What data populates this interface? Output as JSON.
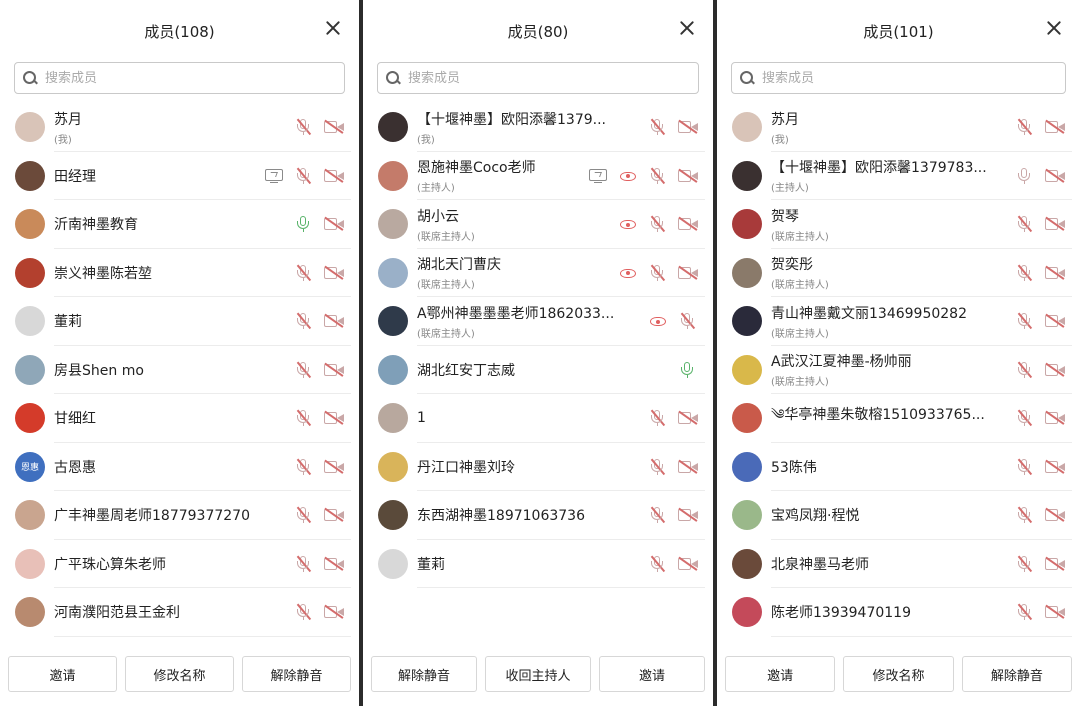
{
  "panels": [
    {
      "title": "成员(108)",
      "search_placeholder": "搜索成员",
      "members": [
        {
          "name": "苏月",
          "role": "(我)",
          "avatar_color": "#d9c4b8",
          "share": false,
          "eye": false,
          "mic": "muted",
          "cam": true
        },
        {
          "name": "田经理",
          "role": "",
          "avatar_color": "#6b4a3a",
          "share": true,
          "eye": false,
          "mic": "muted",
          "cam": true
        },
        {
          "name": "沂南神墨教育",
          "role": "",
          "avatar_color": "#c98a5a",
          "share": false,
          "eye": false,
          "mic": "on",
          "cam": true
        },
        {
          "name": "崇义神墨陈若堃",
          "role": "",
          "avatar_color": "#b3402e",
          "share": false,
          "eye": false,
          "mic": "muted",
          "cam": true
        },
        {
          "name": "董莉",
          "role": "",
          "avatar_color": "#d8d8d8",
          "share": false,
          "eye": false,
          "mic": "muted",
          "cam": true
        },
        {
          "name": "房县Shen mo",
          "role": "",
          "avatar_color": "#8fa7b8",
          "share": false,
          "eye": false,
          "mic": "muted",
          "cam": true
        },
        {
          "name": "甘细红",
          "role": "",
          "avatar_color": "#d43b2a",
          "share": false,
          "eye": false,
          "mic": "muted",
          "cam": true
        },
        {
          "name": "古恩惠",
          "role": "",
          "avatar_color": "#3f6fbf",
          "avatar_text": "恩惠",
          "share": false,
          "eye": false,
          "mic": "muted",
          "cam": true
        },
        {
          "name": "广丰神墨周老师18779377270",
          "role": "",
          "avatar_color": "#c9a58f",
          "share": false,
          "eye": false,
          "mic": "muted",
          "cam": true
        },
        {
          "name": "广平珠心算朱老师",
          "role": "",
          "avatar_color": "#e8c0b8",
          "share": false,
          "eye": false,
          "mic": "muted",
          "cam": true
        },
        {
          "name": "河南濮阳范县王金利",
          "role": "",
          "avatar_color": "#b88a6f",
          "share": false,
          "eye": false,
          "mic": "muted",
          "cam": true
        }
      ],
      "buttons": [
        "邀请",
        "修改名称",
        "解除静音"
      ]
    },
    {
      "title": "成员(80)",
      "search_placeholder": "搜索成员",
      "members": [
        {
          "name": "【十堰神墨】欧阳添馨1379...",
          "role": "(我)",
          "avatar_color": "#3a3030",
          "share": false,
          "eye": false,
          "mic": "muted",
          "cam": true
        },
        {
          "name": "恩施神墨Coco老师",
          "role": "(主持人)",
          "avatar_color": "#c47b6a",
          "share": true,
          "eye": true,
          "mic": "muted",
          "cam": true
        },
        {
          "name": "胡小云",
          "role": "(联席主持人)",
          "avatar_color": "#b9a9a0",
          "share": false,
          "eye": true,
          "mic": "muted",
          "cam": true
        },
        {
          "name": "湖北天门曹庆",
          "role": "(联席主持人)",
          "avatar_color": "#9ab0c8",
          "share": false,
          "eye": true,
          "mic": "muted",
          "cam": true
        },
        {
          "name": "A鄂州神墨墨墨老师1862033...",
          "role": "(联席主持人)",
          "avatar_color": "#2f3a4a",
          "share": false,
          "eye": true,
          "mic": "muted",
          "cam": false
        },
        {
          "name": "湖北红安丁志威",
          "role": "",
          "avatar_color": "#7f9fb8",
          "share": false,
          "eye": false,
          "mic": "on",
          "cam": false
        },
        {
          "name": "1",
          "role": "",
          "avatar_color": "#b8a89e",
          "share": false,
          "eye": false,
          "mic": "muted",
          "cam": true
        },
        {
          "name": "丹江口神墨刘玲",
          "role": "",
          "avatar_color": "#d9b45a",
          "share": false,
          "eye": false,
          "mic": "muted",
          "cam": true
        },
        {
          "name": "东西湖神墨18971063736",
          "role": "",
          "avatar_color": "#5a4a3a",
          "share": false,
          "eye": false,
          "mic": "muted",
          "cam": true
        },
        {
          "name": "董莉",
          "role": "",
          "avatar_color": "#d8d8d8",
          "share": false,
          "eye": false,
          "mic": "muted",
          "cam": true
        }
      ],
      "buttons": [
        "解除静音",
        "收回主持人",
        "邀请"
      ]
    },
    {
      "title": "成员(101)",
      "search_placeholder": "搜索成员",
      "members": [
        {
          "name": "苏月",
          "role": "(我)",
          "avatar_color": "#d9c4b8",
          "share": false,
          "eye": false,
          "mic": "muted",
          "cam": true
        },
        {
          "name": "【十堰神墨】欧阳添馨1379783...",
          "role": "(主持人)",
          "avatar_color": "#3a3030",
          "share": false,
          "eye": false,
          "mic": "plain",
          "cam": true
        },
        {
          "name": "贺琴",
          "role": "(联席主持人)",
          "avatar_color": "#a83a3a",
          "share": false,
          "eye": false,
          "mic": "muted",
          "cam": true
        },
        {
          "name": "贺奕彤",
          "role": "(联席主持人)",
          "avatar_color": "#8a7a6a",
          "share": false,
          "eye": false,
          "mic": "muted",
          "cam": true
        },
        {
          "name": "青山神墨戴文丽13469950282",
          "role": "(联席主持人)",
          "avatar_color": "#2a2a3a",
          "share": false,
          "eye": false,
          "mic": "muted",
          "cam": true
        },
        {
          "name": "A武汉江夏神墨-杨帅丽",
          "role": "(联席主持人)",
          "avatar_color": "#d9b84a",
          "share": false,
          "eye": false,
          "mic": "muted",
          "cam": true
        },
        {
          "name": "༄华亭神墨朱敬榕1510933765...",
          "role": "",
          "avatar_color": "#c95a4a",
          "share": false,
          "eye": false,
          "mic": "muted",
          "cam": true
        },
        {
          "name": "53陈伟",
          "role": "",
          "avatar_color": "#4a6ab8",
          "share": false,
          "eye": false,
          "mic": "muted",
          "cam": true
        },
        {
          "name": "宝鸡凤翔·程悦",
          "role": "",
          "avatar_color": "#9ab88a",
          "share": false,
          "eye": false,
          "mic": "muted",
          "cam": true
        },
        {
          "name": "北泉神墨马老师",
          "role": "",
          "avatar_color": "#6a4a3a",
          "share": false,
          "eye": false,
          "mic": "muted",
          "cam": true
        },
        {
          "name": "陈老师13939470119",
          "role": "",
          "avatar_color": "#c44a5a",
          "share": false,
          "eye": false,
          "mic": "muted",
          "cam": true
        }
      ],
      "buttons": [
        "邀请",
        "修改名称",
        "解除静音"
      ]
    }
  ]
}
